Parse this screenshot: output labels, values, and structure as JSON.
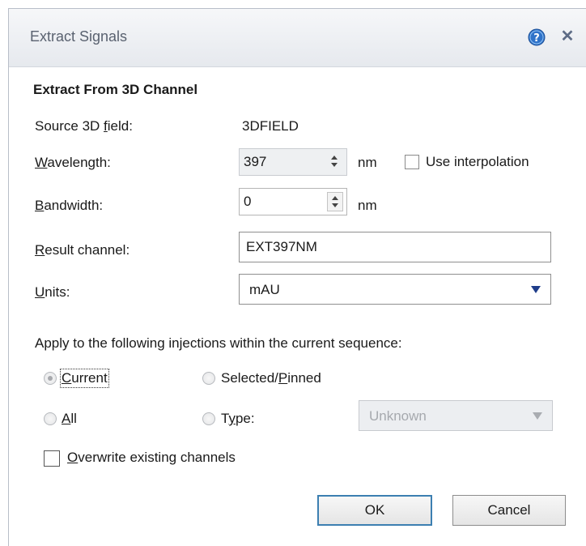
{
  "dialog": {
    "title": "Extract Signals",
    "help_icon": "help-question-icon",
    "close_icon": "close-x-icon"
  },
  "section": {
    "heading": "Extract From 3D Channel"
  },
  "fields": {
    "source_label_pre": "Source 3D ",
    "source_label_key": "f",
    "source_label_post": "ield:",
    "source_value": "3DFIELD",
    "wavelength_label_key": "W",
    "wavelength_label_post": "avelength:",
    "wavelength_value": "397",
    "wavelength_unit": "nm",
    "use_interpolation_label": "Use interpolation",
    "use_interpolation_checked": false,
    "bandwidth_label_key": "B",
    "bandwidth_label_post": "andwidth:",
    "bandwidth_value": "0",
    "bandwidth_unit": "nm",
    "result_label_key": "R",
    "result_label_post": "esult channel:",
    "result_value": "EXT397NM",
    "units_label_key": "U",
    "units_label_post": "nits:",
    "units_value": "mAU"
  },
  "injections": {
    "prompt": "Apply to the following injections within the current sequence:",
    "current_key": "C",
    "current_post": "urrent",
    "selected_pre": "Selected/",
    "selected_key": "P",
    "selected_post": "inned",
    "all_key": "A",
    "all_post": "ll",
    "type_pre": "T",
    "type_key": "y",
    "type_post": "pe:",
    "type_value": "Unknown",
    "selected_option": "Current"
  },
  "overwrite": {
    "key": "O",
    "post": "verwrite existing channels",
    "checked": false
  },
  "buttons": {
    "ok": "OK",
    "cancel": "Cancel"
  },
  "colors": {
    "default_button_border": "#3c7fb1",
    "help_icon": "#2f73c9",
    "dropdown_caret": "#1f3d8a"
  }
}
